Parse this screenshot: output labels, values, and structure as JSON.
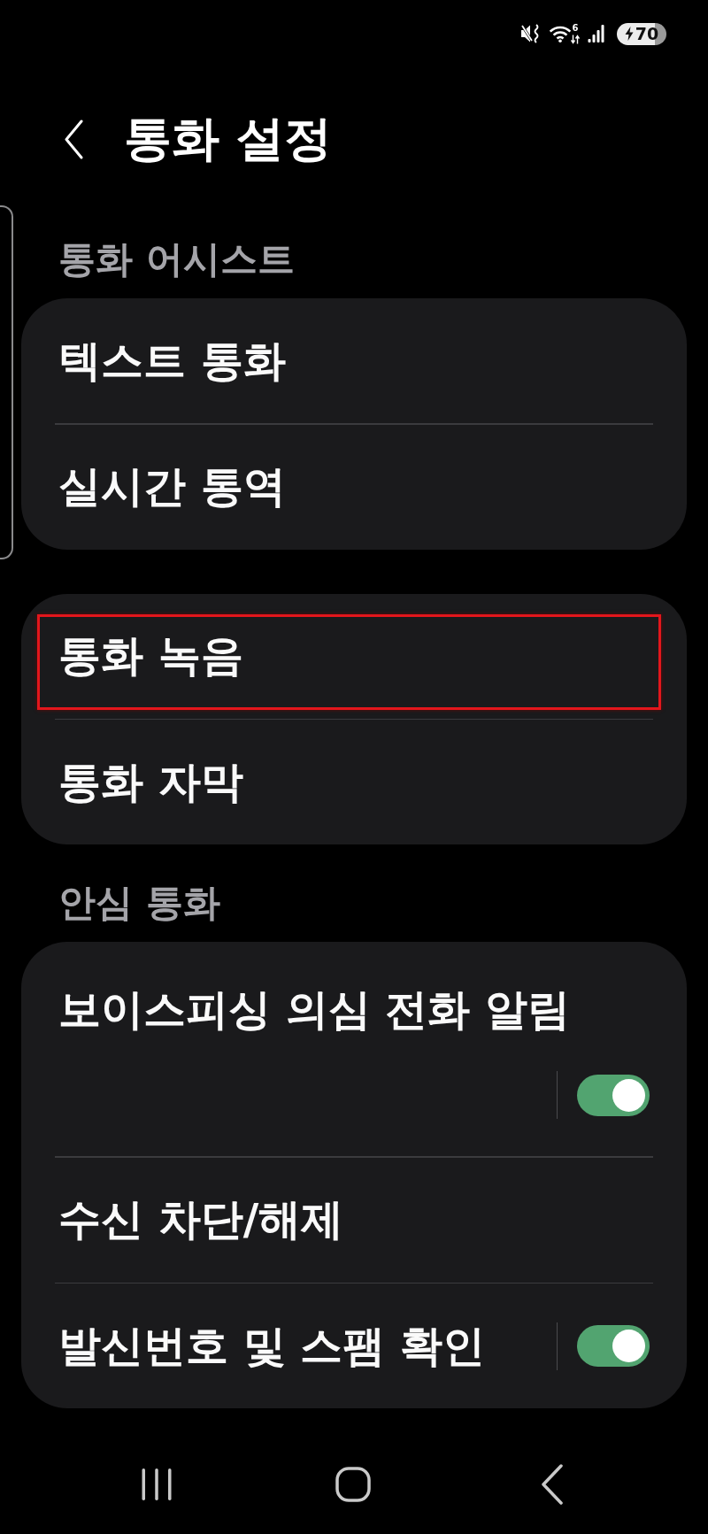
{
  "status_bar": {
    "wifi_standard": "6",
    "charging": true,
    "battery": "70"
  },
  "header": {
    "title": "통화 설정"
  },
  "sections": [
    {
      "title": "통화 어시스트",
      "items": [
        {
          "label": "텍스트 통화",
          "kind": "link",
          "highlighted": false
        },
        {
          "label": "실시간 통역",
          "kind": "link",
          "highlighted": false
        }
      ]
    },
    {
      "items": [
        {
          "label": "통화 녹음",
          "kind": "link",
          "highlighted": true
        },
        {
          "label": "통화 자막",
          "kind": "link",
          "highlighted": false
        }
      ]
    },
    {
      "title": "안심 통화",
      "items": [
        {
          "label": "보이스피싱 의심 전화 알림",
          "kind": "switchbelow",
          "on": true,
          "highlighted": false
        },
        {
          "label": "수신 차단/해제",
          "kind": "link",
          "highlighted": false
        },
        {
          "label": "발신번호 및 스팸 확인",
          "kind": "switch",
          "on": true,
          "highlighted": false
        }
      ]
    }
  ]
}
